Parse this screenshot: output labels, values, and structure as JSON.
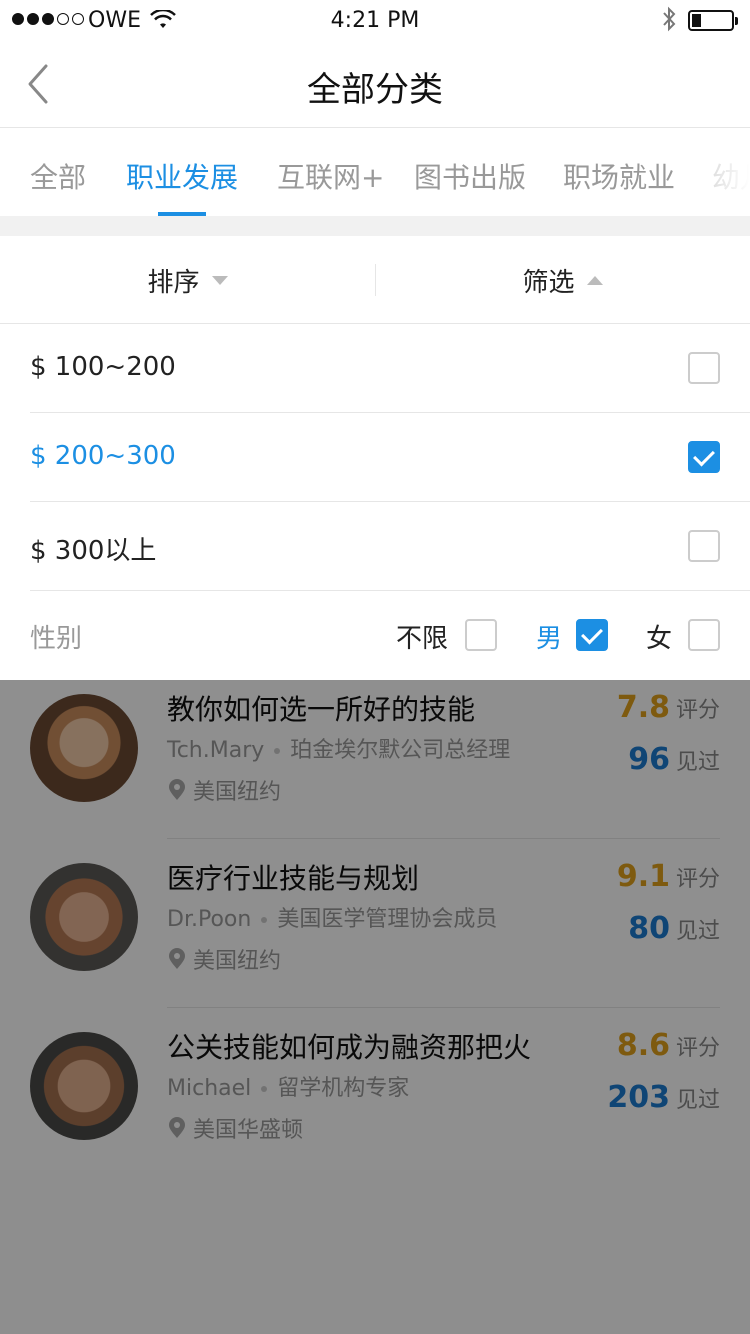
{
  "status_bar": {
    "carrier": "OWE",
    "time": "4:21 PM",
    "signal_bars_filled": 3,
    "signal_bars_total": 5,
    "battery_level_fraction": 0.2,
    "icons": [
      "wifi-icon",
      "bluetooth-icon",
      "battery-icon"
    ]
  },
  "navbar": {
    "title": "全部分类",
    "back_icon": "chevron-left-icon"
  },
  "tabs": {
    "items": [
      "全部",
      "职业发展",
      "互联网+",
      "图书出版",
      "职场就业",
      "幼儿"
    ],
    "active_index": 1
  },
  "sortbar": {
    "sort_label": "排序",
    "filter_label": "筛选"
  },
  "filter_panel": {
    "price_options": [
      {
        "label": "$ 100~200",
        "checked": false
      },
      {
        "label": "$ 200~300",
        "checked": true
      },
      {
        "label": "$ 300以上",
        "checked": false
      }
    ],
    "gender": {
      "label": "性别",
      "options": [
        {
          "label": "不限",
          "checked": false
        },
        {
          "label": "男",
          "checked": true
        },
        {
          "label": "女",
          "checked": false
        }
      ]
    }
  },
  "list": {
    "items": [
      {
        "title": "教你如何选一所好的技能",
        "name": "Tch.Mary",
        "role": "珀金埃尔默公司总经理",
        "location": "美国纽约",
        "score": "7.8",
        "score_unit": "评分",
        "seen": "96",
        "seen_unit": "见过"
      },
      {
        "title": "医疗行业技能与规划",
        "name": "Dr.Poon",
        "role": "美国医学管理协会成员",
        "location": "美国纽约",
        "score": "9.1",
        "score_unit": "评分",
        "seen": "80",
        "seen_unit": "见过"
      },
      {
        "title": "公关技能如何成为融资那把火",
        "name": "Michael",
        "role": "留学机构专家",
        "location": "美国华盛顿",
        "score": "8.6",
        "score_unit": "评分",
        "seen": "203",
        "seen_unit": "见过"
      }
    ]
  },
  "colors": {
    "accent": "#1c8fe3",
    "score": "#e0a11c",
    "seen": "#1c7bd0",
    "muted": "#999999"
  }
}
